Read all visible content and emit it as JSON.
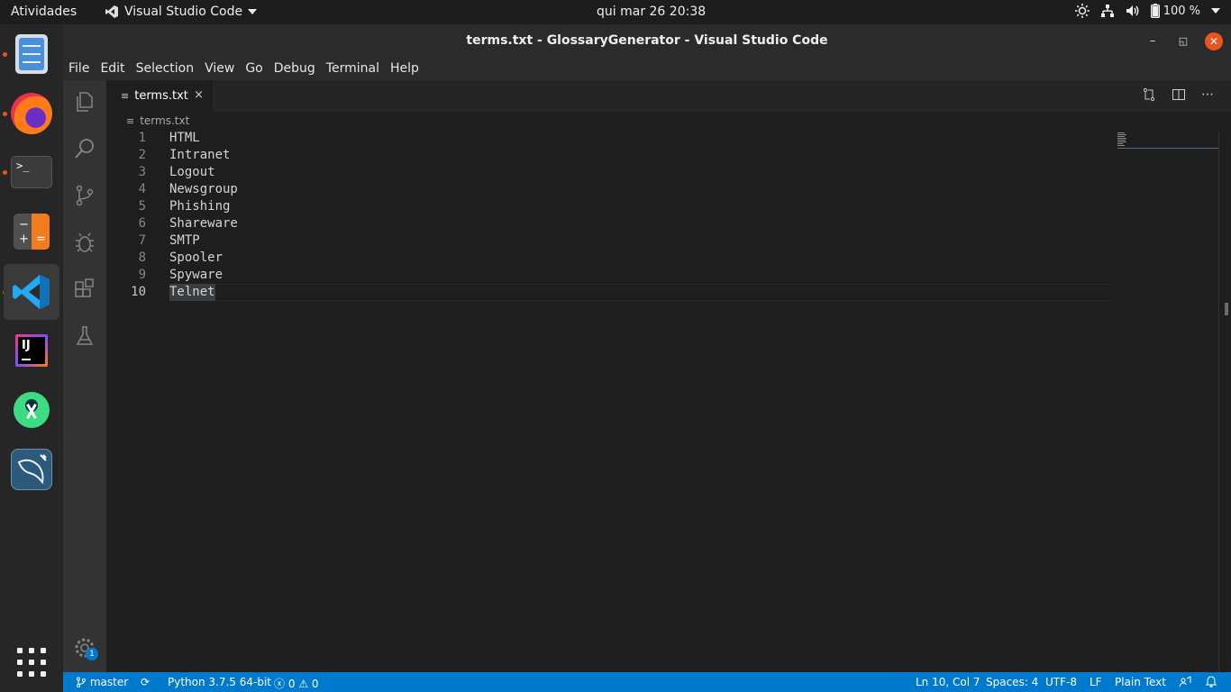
{
  "topbar": {
    "activities": "Atividades",
    "app_name": "Visual Studio Code",
    "clock": "qui mar 26  20:38",
    "battery": "100 %"
  },
  "dock": {
    "apps": [
      "file-manager",
      "firefox",
      "terminal",
      "calculator",
      "vscode",
      "intellij",
      "android-studio",
      "mysql-workbench"
    ]
  },
  "window": {
    "title": "terms.txt - GlossaryGenerator - Visual Studio Code"
  },
  "menubar": [
    "File",
    "Edit",
    "Selection",
    "View",
    "Go",
    "Debug",
    "Terminal",
    "Help"
  ],
  "activity_badge": "1",
  "tab": {
    "label": "terms.txt",
    "close": "×"
  },
  "breadcrumb": "terms.txt",
  "editor": {
    "lines": [
      {
        "n": "1",
        "text": "HTML"
      },
      {
        "n": "2",
        "text": "Intranet"
      },
      {
        "n": "3",
        "text": "Logout"
      },
      {
        "n": "4",
        "text": "Newsgroup"
      },
      {
        "n": "5",
        "text": "Phishing"
      },
      {
        "n": "6",
        "text": "Shareware"
      },
      {
        "n": "7",
        "text": "SMTP"
      },
      {
        "n": "8",
        "text": "Spooler"
      },
      {
        "n": "9",
        "text": "Spyware"
      },
      {
        "n": "10",
        "text": "Telnet"
      }
    ]
  },
  "statusbar": {
    "branch": "master",
    "python": "Python 3.7.5 64-bit",
    "errors": "0",
    "warnings": "0",
    "position": "Ln 10, Col 7",
    "spaces": "Spaces: 4",
    "encoding": "UTF-8",
    "eol": "LF",
    "language": "Plain Text"
  },
  "colors": {
    "accent": "#007acc",
    "ubuntu_orange": "#e95420"
  }
}
